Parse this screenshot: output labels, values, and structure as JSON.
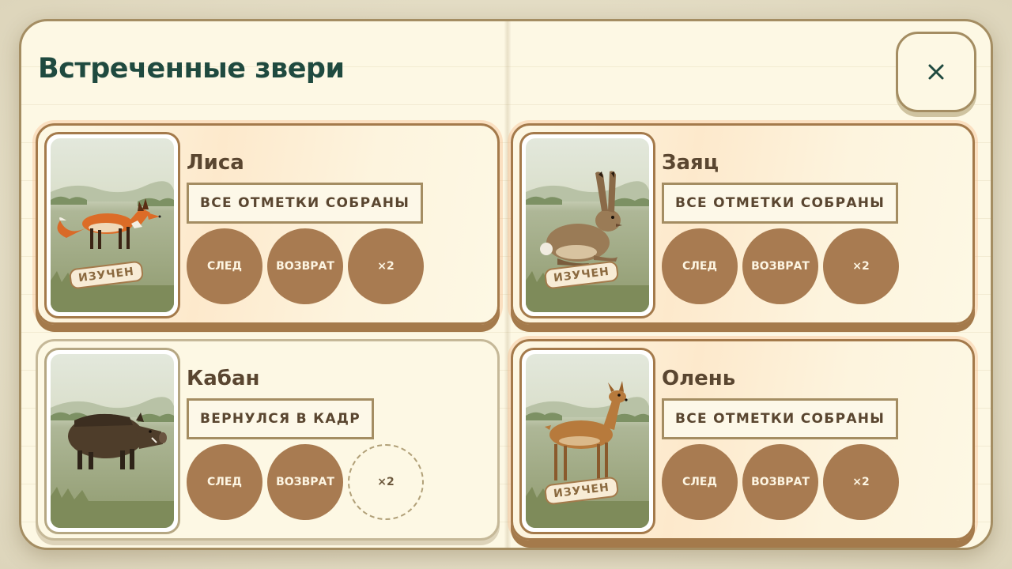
{
  "title": "Встреченные звери",
  "close_label": "×",
  "cards": [
    {
      "name": "Лиса",
      "status": "ВСЕ ОТМЕТКИ СОБРАНЫ",
      "studied_label": "ИЗУЧЕН",
      "marks": [
        "СЛЕД",
        "ВОЗВРАТ",
        "×2"
      ]
    },
    {
      "name": "Заяц",
      "status": "ВСЕ ОТМЕТКИ СОБРАНЫ",
      "studied_label": "ИЗУЧЕН",
      "marks": [
        "СЛЕД",
        "ВОЗВРАТ",
        "×2"
      ]
    },
    {
      "name": "Кабан",
      "status": "ВЕРНУЛСЯ В КАДР",
      "marks": [
        "СЛЕД",
        "ВОЗВРАТ",
        "×2"
      ]
    },
    {
      "name": "Олень",
      "status": "ВСЕ ОТМЕТКИ СОБРАНЫ",
      "studied_label": "ИЗУЧЕН",
      "marks": [
        "СЛЕД",
        "ВОЗВРАТ",
        "×2"
      ]
    }
  ],
  "colors": {
    "title": "#1f4a3f",
    "card_border": "#a47a4b",
    "mark_fill": "#a87b51",
    "paper": "#fdf8e4"
  }
}
